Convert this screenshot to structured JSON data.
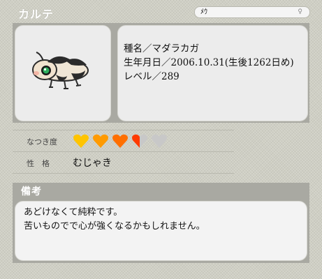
{
  "header": {
    "title": "カルテ",
    "name": "ﾒｳ",
    "gender_mark": "♀"
  },
  "profile": {
    "species": "種名／マダラカガ",
    "birthdate": "生年月日／2006.10.31(生後1262日め)",
    "level": "レベル／289"
  },
  "stats": {
    "affection_label": "なつき度",
    "affection_value": 3.5,
    "affection_max": 5,
    "heart_colors": [
      "#ffc400",
      "#ff9a00",
      "#ff6f00",
      "#ff3b00",
      "#c8c8c8"
    ],
    "personality_label": "性　格",
    "personality_value": "むじゃき"
  },
  "notes": {
    "title": "備考",
    "text_line1": "あどけなくて純粋です。",
    "text_line2": "苦いものでで心が強くなるかもしれません。"
  }
}
